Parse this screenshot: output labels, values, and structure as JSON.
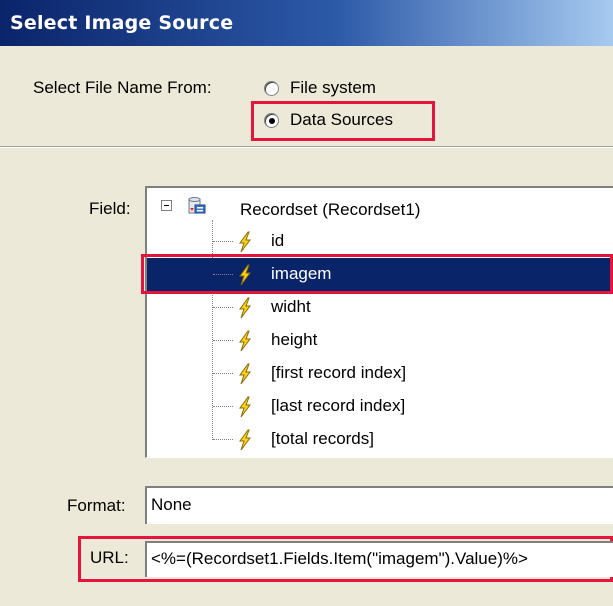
{
  "dialog": {
    "title": "Select Image Source"
  },
  "source": {
    "label": "Select File Name From:",
    "options": [
      {
        "label": "File system",
        "selected": false
      },
      {
        "label": "Data Sources",
        "selected": true
      }
    ]
  },
  "field": {
    "label": "Field:",
    "recordset": "Recordset (Recordset1)",
    "items": [
      "id",
      "imagem",
      "widht",
      "height",
      "[first record index]",
      "[last record index]",
      "[total records]"
    ],
    "selected": "imagem"
  },
  "format": {
    "label": "Format:",
    "value": "None"
  },
  "url": {
    "label": "URL:",
    "value": "<%=(Recordset1.Fields.Item(\"imagem\").Value)%>"
  },
  "colors": {
    "highlight": "#e4143c",
    "selection": "#0a246a",
    "title_bar": "#0a246a"
  },
  "icons": {
    "recordset": "database-recordset-icon",
    "field": "lightning-bolt-icon"
  }
}
